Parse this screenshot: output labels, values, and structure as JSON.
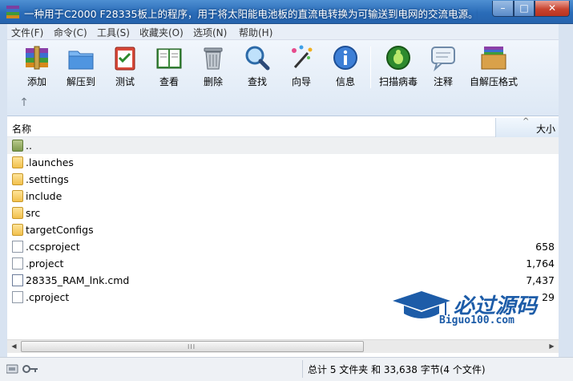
{
  "window": {
    "title": "一种用于C2000 F28335板上的程序，用于将太阳能电池板的直流电转换为可输送到电网的交流电源。需",
    "minimize": "–",
    "maximize": "□",
    "close": "✕"
  },
  "menu": {
    "items": [
      {
        "label": "文件(F)"
      },
      {
        "label": "命令(C)"
      },
      {
        "label": "工具(S)"
      },
      {
        "label": "收藏夹(O)"
      },
      {
        "label": "选项(N)"
      },
      {
        "label": "帮助(H)"
      }
    ]
  },
  "toolbar": {
    "buttons": [
      {
        "label": "添加",
        "icon": "add-archive-icon"
      },
      {
        "label": "解压到",
        "icon": "extract-folder-icon"
      },
      {
        "label": "测试",
        "icon": "test-clipboard-icon"
      },
      {
        "label": "查看",
        "icon": "view-book-icon"
      },
      {
        "label": "删除",
        "icon": "trash-icon"
      },
      {
        "label": "查找",
        "icon": "magnifier-icon"
      },
      {
        "label": "向导",
        "icon": "wizard-wand-icon"
      },
      {
        "label": "信息",
        "icon": "info-icon"
      },
      {
        "label": "扫描病毒",
        "icon": "virus-scan-icon"
      },
      {
        "label": "注释",
        "icon": "comment-icon"
      },
      {
        "label": "自解压格式",
        "icon": "sfx-box-icon"
      }
    ],
    "up_arrow": "↑"
  },
  "columns": {
    "name": "名称",
    "size": "大小",
    "sort_indicator": "^"
  },
  "files": [
    {
      "name": "..",
      "size": "",
      "type": "up"
    },
    {
      "name": ".launches",
      "size": "",
      "type": "folder"
    },
    {
      "name": ".settings",
      "size": "",
      "type": "folder"
    },
    {
      "name": "include",
      "size": "",
      "type": "folder"
    },
    {
      "name": "src",
      "size": "",
      "type": "folder"
    },
    {
      "name": "targetConfigs",
      "size": "",
      "type": "folder"
    },
    {
      "name": ".ccsproject",
      "size": "658",
      "type": "file"
    },
    {
      "name": ".project",
      "size": "1,764",
      "type": "file"
    },
    {
      "name": "28335_RAM_lnk.cmd",
      "size": "7,437",
      "type": "cmd"
    },
    {
      "name": ".cproject",
      "size": "29",
      "type": "file"
    }
  ],
  "watermark": {
    "text": "必过源码",
    "url": "Biguo100.com"
  },
  "scrollbar": {
    "left": "◀",
    "right": "▶",
    "grip": "III"
  },
  "status": {
    "summary": "总计 5 文件夹 和 33,638 字节(4 个文件)"
  }
}
